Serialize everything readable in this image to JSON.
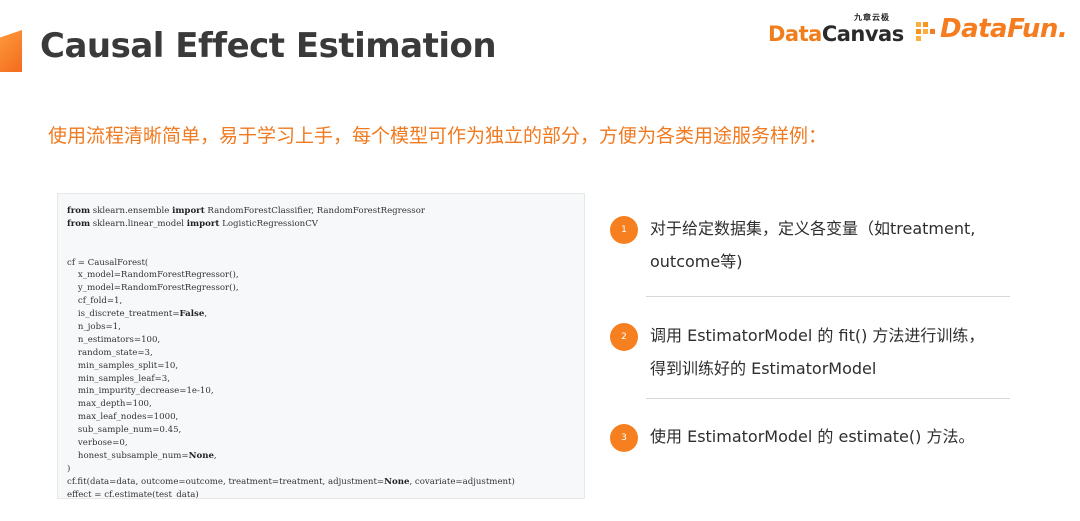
{
  "header": {
    "title": "Causal Effect Estimation",
    "logo_datacanvas_small": "九章云极",
    "logo_datacanvas_data": "Data",
    "logo_datacanvas_canvas": "Canvas",
    "logo_datafun": "DataFun."
  },
  "subtitle": "使用流程清晰简单，易于学习上手，每个模型可作为独立的部分，方便为各类用途服务样例：",
  "code": {
    "lines": [
      [
        {
          "t": "from",
          "k": true
        },
        {
          "t": " sklearn.ensemble "
        },
        {
          "t": "import",
          "k": true
        },
        {
          "t": " RandomForestClassifier, RandomForestRegressor"
        }
      ],
      [
        {
          "t": "from",
          "k": true
        },
        {
          "t": " sklearn.linear_model "
        },
        {
          "t": "import",
          "k": true
        },
        {
          "t": " LogisticRegressionCV"
        }
      ],
      [],
      [],
      [
        {
          "t": "cf = CausalForest("
        }
      ],
      [
        {
          "t": "    x_model=RandomForestRegressor(),"
        }
      ],
      [
        {
          "t": "    y_model=RandomForestRegressor(),"
        }
      ],
      [
        {
          "t": "    cf_fold=1,"
        }
      ],
      [
        {
          "t": "    is_discrete_treatment="
        },
        {
          "t": "False",
          "k": true
        },
        {
          "t": ","
        }
      ],
      [
        {
          "t": "    n_jobs=1,"
        }
      ],
      [
        {
          "t": "    n_estimators=100,"
        }
      ],
      [
        {
          "t": "    random_state=3,"
        }
      ],
      [
        {
          "t": "    min_samples_split=10,"
        }
      ],
      [
        {
          "t": "    min_samples_leaf=3,"
        }
      ],
      [
        {
          "t": "    min_impurity_decrease=1e-10,"
        }
      ],
      [
        {
          "t": "    max_depth=100,"
        }
      ],
      [
        {
          "t": "    max_leaf_nodes=1000,"
        }
      ],
      [
        {
          "t": "    sub_sample_num=0.45,"
        }
      ],
      [
        {
          "t": "    verbose=0,"
        }
      ],
      [
        {
          "t": "    honest_subsample_num="
        },
        {
          "t": "None",
          "k": true
        },
        {
          "t": ","
        }
      ],
      [
        {
          "t": ")"
        }
      ],
      [
        {
          "t": "cf.fit(data=data, outcome=outcome, treatment=treatment, adjustment="
        },
        {
          "t": "None",
          "k": true
        },
        {
          "t": ", covariate=adjustment)"
        }
      ],
      [
        {
          "t": "effect = cf.estimate(test_data)"
        }
      ]
    ]
  },
  "steps": [
    {
      "num": "1",
      "line1": "对于给定数据集，定义各变量（如treatment,",
      "line2": "outcome等)"
    },
    {
      "num": "2",
      "line1": "调用 EstimatorModel 的 fit() 方法进行训练，",
      "line2": "得到训练好的 EstimatorModel"
    },
    {
      "num": "3",
      "line1": "使用 EstimatorModel 的 estimate() 方法。",
      "line2": ""
    }
  ],
  "colors": {
    "accent": "#f6801f",
    "title": "#3a3a3a",
    "subtitle": "#f07a20",
    "code_bg": "#f6f8fa"
  }
}
